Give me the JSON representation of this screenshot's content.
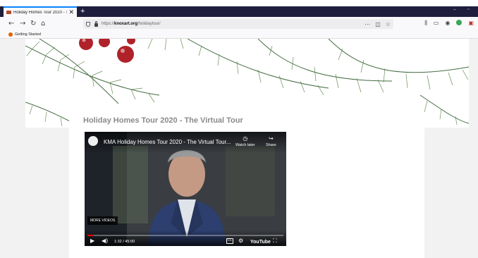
{
  "browser": {
    "tab_title": "Holiday Homes Tour 2020 - Th",
    "tab_close": "✕",
    "new_tab": "+",
    "win_min": "–",
    "win_max": "▫",
    "url_protocol": "https://",
    "url_host": "knoxart.org",
    "url_path": "/holidaytour/",
    "bookmark_label": "Getting Started"
  },
  "page": {
    "heading": "Holiday Homes Tour 2020 - The Virtual Tour"
  },
  "video": {
    "title": "KMA Holiday Homes Tour 2020 - The Virtual Tour...",
    "watch_later": "Watch later",
    "share": "Share",
    "more_videos": "MORE VIDEOS",
    "time": "1:32 / 45:00",
    "progress": 0.034,
    "cc": "CC",
    "brand": "YouTube"
  },
  "colors": {
    "tab_accent": "#0a84ff",
    "progress": "#ff0000",
    "berry": "#b0222a"
  }
}
